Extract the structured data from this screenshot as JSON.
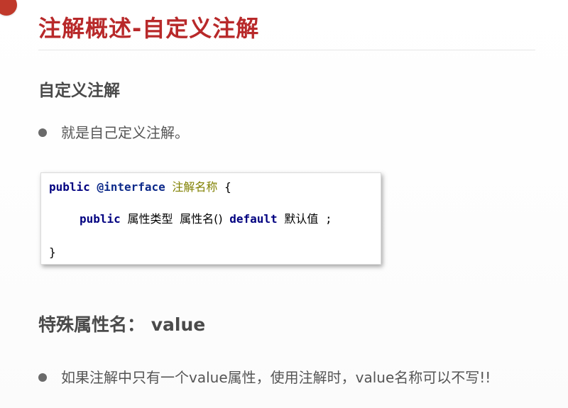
{
  "slide": {
    "title": "注解概述-自定义注解",
    "accent_color": "#b8292a",
    "corner_icon": "red-circle-icon"
  },
  "section_custom": {
    "heading": "自定义注解",
    "bullet": "就是自己定义注解。"
  },
  "code": {
    "line1": {
      "kw_public": "public",
      "kw_interface": "@interface",
      "name": "注解名称",
      "brace_open": "{"
    },
    "line2": {
      "kw_public": "public",
      "type": "属性类型",
      "attr": "属性名()",
      "kw_default": "default",
      "value": "默认值",
      "semicolon": ";"
    },
    "line3": {
      "brace_close": "}"
    }
  },
  "section_value": {
    "heading": "特殊属性名： value",
    "bullet": "如果注解中只有一个value属性，使用注解时，value名称可以不写!!"
  }
}
